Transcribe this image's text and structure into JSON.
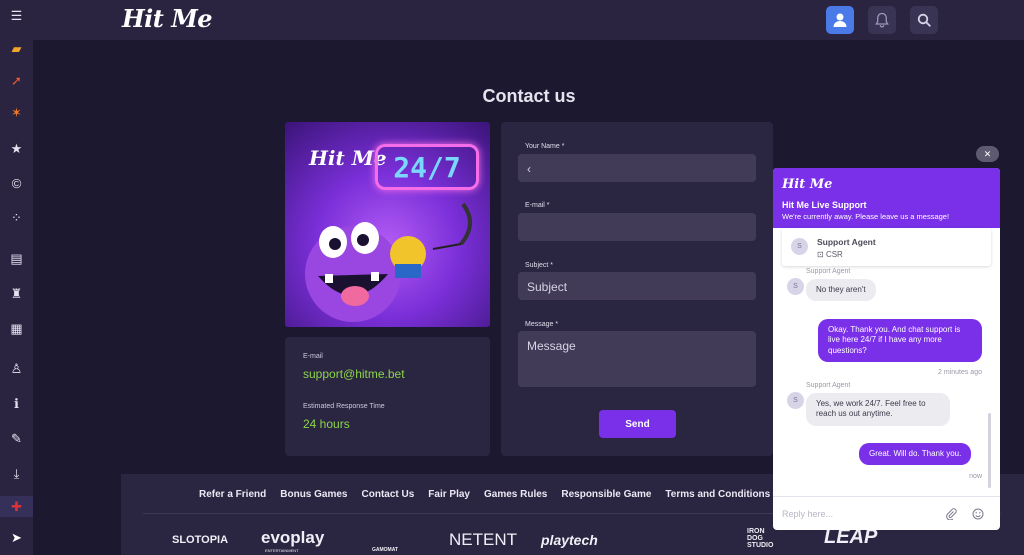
{
  "app": {
    "logo": "Hit Me"
  },
  "sidebar": {
    "items": [
      {
        "icon": "menu-icon",
        "glyph": "☰"
      },
      {
        "icon": "tickets-icon",
        "glyph": "▰"
      },
      {
        "icon": "rocket-icon",
        "glyph": "➚"
      },
      {
        "icon": "megaphone-icon",
        "glyph": "✶"
      },
      {
        "icon": "star-icon",
        "glyph": "★"
      },
      {
        "icon": "coin-icon",
        "glyph": "©"
      },
      {
        "icon": "dice-icon",
        "glyph": "⁘"
      },
      {
        "icon": "gift-icon",
        "glyph": "▤"
      },
      {
        "icon": "trophy-icon",
        "glyph": "♜"
      },
      {
        "icon": "store-icon",
        "glyph": "▦"
      },
      {
        "icon": "joystick-icon",
        "glyph": "♙"
      },
      {
        "icon": "info-icon",
        "glyph": "ℹ"
      },
      {
        "icon": "edit-icon",
        "glyph": "✎"
      },
      {
        "icon": "download-icon",
        "glyph": "⤓"
      },
      {
        "icon": "uk-flag-icon",
        "glyph": "✚"
      },
      {
        "icon": "telegram-icon",
        "glyph": "➤"
      }
    ]
  },
  "header": {
    "title": "Contact us"
  },
  "promo": {
    "logo": "Hit Me",
    "badge": "24/7"
  },
  "contact": {
    "email_label": "E-mail",
    "email_value": "support@hitme.bet",
    "response_label": "Estimated Response Time",
    "response_value": "24 hours"
  },
  "form": {
    "name_label": "Your Name *",
    "name_value": "‹",
    "email_label": "E-mail *",
    "email_value": "",
    "subject_label": "Subject *",
    "subject_placeholder": "Subject",
    "message_label": "Message *",
    "message_placeholder": "Message",
    "send_label": "Send"
  },
  "footer": {
    "links": [
      "Refer a Friend",
      "Bonus Games",
      "Contact Us",
      "Fair Play",
      "Games Rules",
      "Responsible Game",
      "Terms and Conditions"
    ],
    "providers": [
      "SLOTOPIA",
      "evoplay",
      "ENTERTAINMENT",
      "GAMOMAT",
      "NETENT",
      "playtech",
      "IRON DOG STUDIO",
      "LEAP"
    ]
  },
  "chat": {
    "close_glyph": "✕",
    "logo": "Hit Me",
    "title": "Hit Me Live Support",
    "subtitle": "We're currently away. Please leave us a message!",
    "agent_initial": "S",
    "agent_name": "Support Agent",
    "agent_role": "CSR",
    "messages": [
      {
        "from": "agent",
        "sender": "Support Agent",
        "text": "No they aren't"
      },
      {
        "from": "user",
        "text": "Okay. Thank you. And chat support is live here 24/7 if I have any more questions?",
        "time": "2 minutes ago"
      },
      {
        "from": "agent",
        "sender": "Support Agent",
        "text": "Yes, we work 24/7. Feel free to reach us out anytime."
      },
      {
        "from": "user",
        "text": "Great. Will do. Thank you.",
        "time": "now"
      }
    ],
    "input_placeholder": "Reply here..."
  },
  "colors": {
    "accent": "#7a2fe8",
    "email_green": "#8cd44a",
    "user_button": "#4a7ae8"
  }
}
